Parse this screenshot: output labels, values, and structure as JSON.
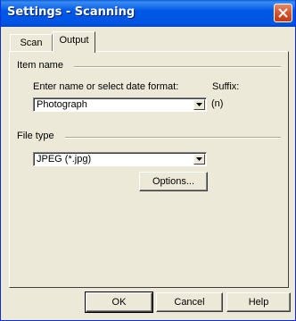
{
  "window": {
    "title": "Settings - Scanning",
    "close_icon": "close-icon"
  },
  "tabs": [
    {
      "label": "Scan",
      "selected": false
    },
    {
      "label": "Output",
      "selected": true
    }
  ],
  "item_name": {
    "group_label": "Item name",
    "prompt_label": "Enter name or select date format:",
    "name_value": "Photograph",
    "suffix_label": "Suffix:",
    "suffix_value": "(n)"
  },
  "file_type": {
    "group_label": "File type",
    "selected_value": "JPEG (*.jpg)",
    "options_button": "Options..."
  },
  "buttons": {
    "ok": "OK",
    "cancel": "Cancel",
    "help": "Help"
  },
  "colors": {
    "titlebar": "#0054e3",
    "face": "#ece9d8",
    "close": "#d8532d"
  }
}
